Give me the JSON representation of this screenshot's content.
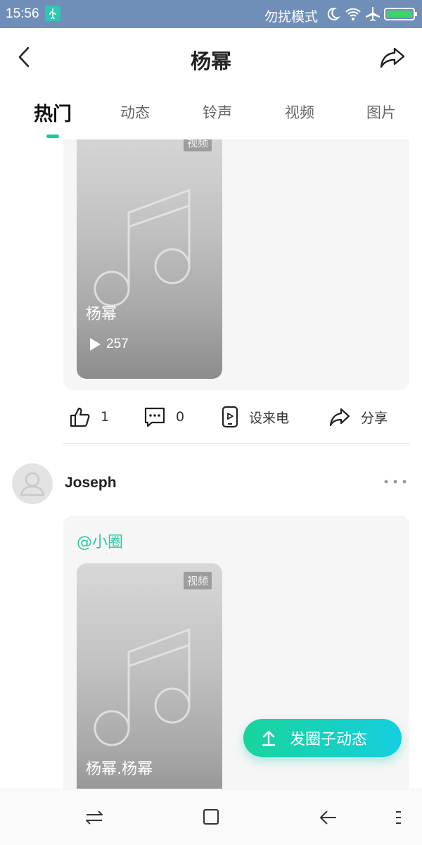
{
  "status_bar": {
    "time": "15:56",
    "dnd_label": "勿扰模式"
  },
  "header": {
    "title": "杨幂"
  },
  "tabs": [
    {
      "label": "热门",
      "active": true
    },
    {
      "label": "动态",
      "active": false
    },
    {
      "label": "铃声",
      "active": false
    },
    {
      "label": "视频",
      "active": false
    },
    {
      "label": "图片",
      "active": false
    }
  ],
  "posts": [
    {
      "media": {
        "badge": "视频",
        "caption": "杨幂",
        "play_count": "257"
      },
      "actions": {
        "like_count": "1",
        "comment_count": "0",
        "ringtone_label": "设来电",
        "share_label": "分享"
      }
    },
    {
      "author": "Joseph",
      "mention": "@小圈",
      "media": {
        "badge": "视频",
        "caption": "杨幂.杨幂"
      }
    }
  ],
  "fab": {
    "label": "发圈子动态"
  },
  "colors": {
    "accent": "#1fc99e",
    "status_bar": "#6f8fb8",
    "mention": "#2cc9a0"
  }
}
